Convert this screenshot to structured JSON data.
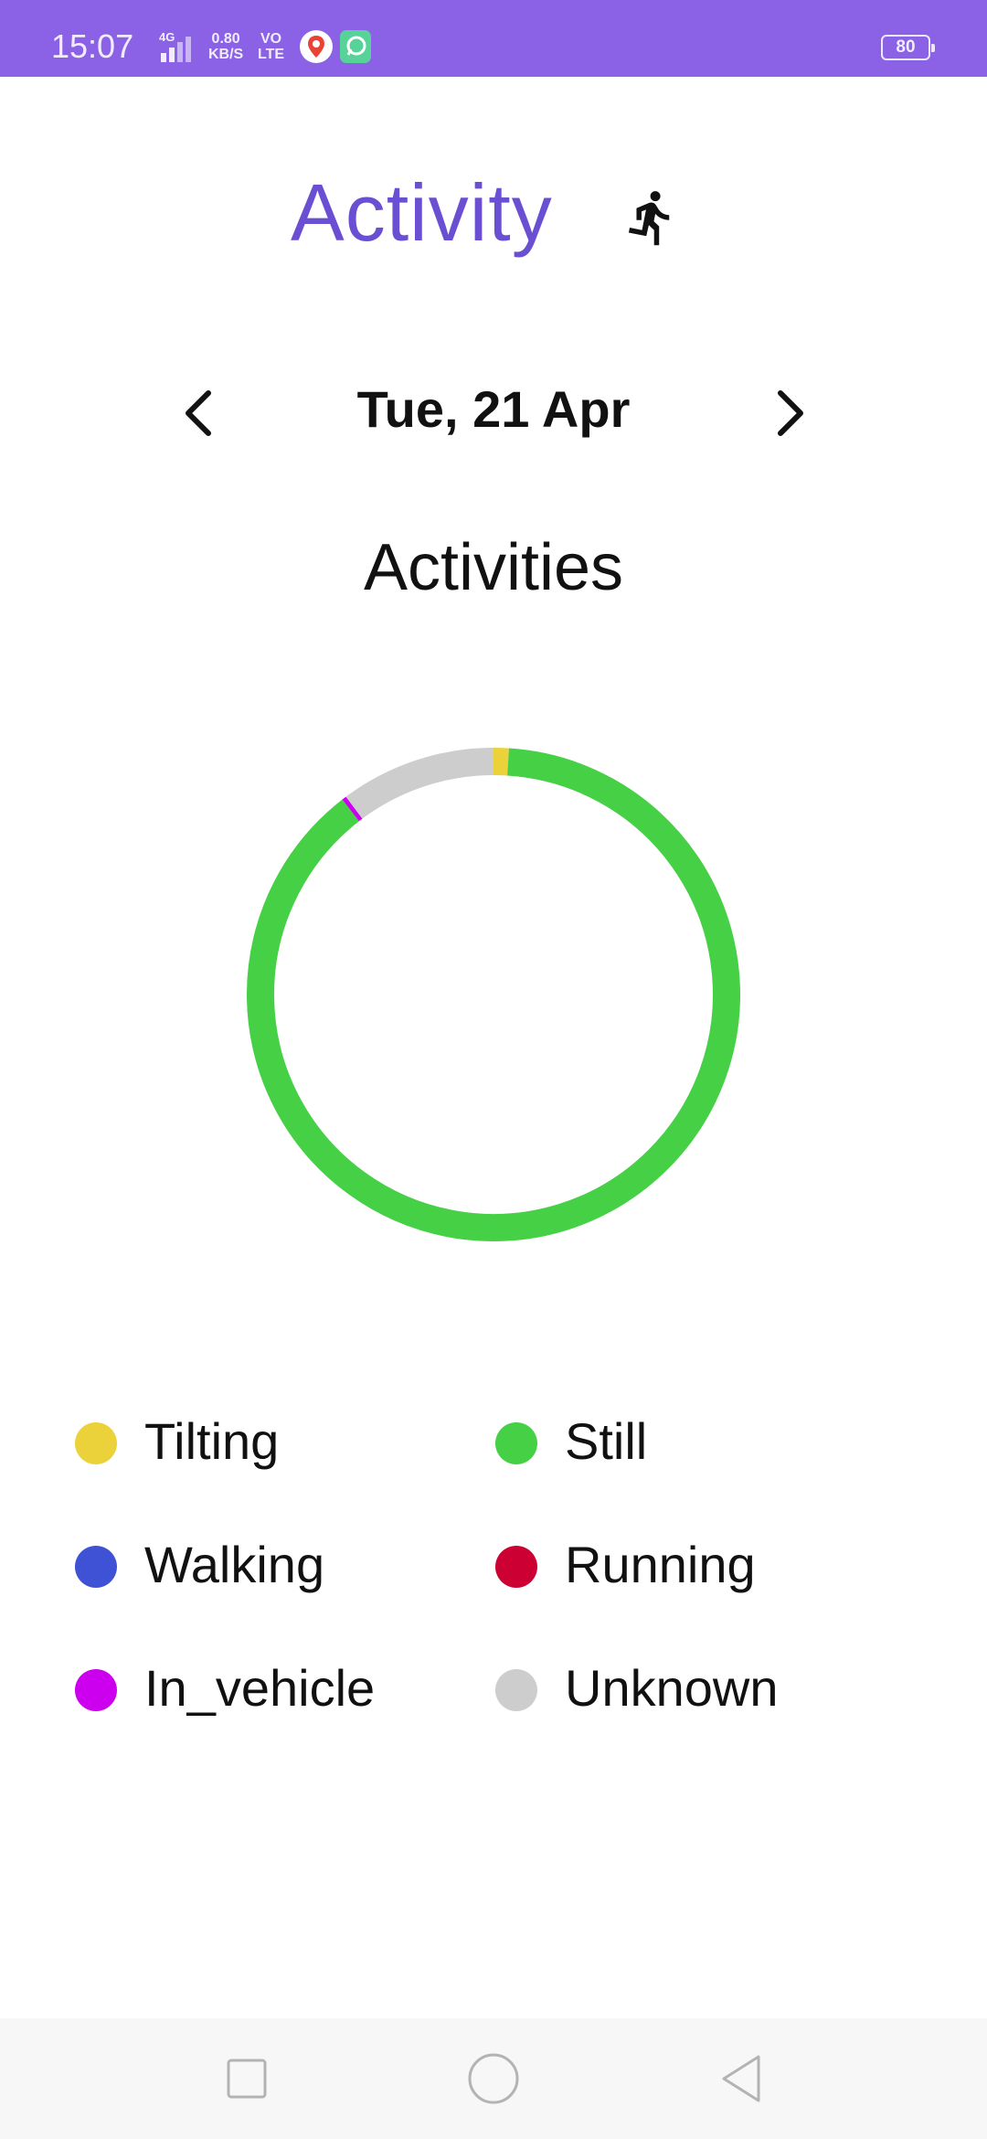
{
  "status_bar": {
    "time": "15:07",
    "network_type": "4G",
    "data_speed_value": "0.80",
    "data_speed_unit": "KB/S",
    "volte_top": "VO",
    "volte_bottom": "LTE",
    "battery": "80",
    "icons": [
      "signal-icon",
      "maps-app-icon",
      "chat-app-icon",
      "battery-icon"
    ]
  },
  "header": {
    "title": "Activity",
    "title_color": "#6a4fd3",
    "icon": "running-person-icon"
  },
  "date_nav": {
    "date": "Tue, 21 Apr",
    "prev_icon": "chevron-left-icon",
    "next_icon": "chevron-right-icon"
  },
  "section": {
    "title": "Activities"
  },
  "chart_data": {
    "type": "pie",
    "title": "Activities",
    "donut": true,
    "slices": [
      {
        "label": "Tilting",
        "value": 1.0,
        "color": "#ecd23a"
      },
      {
        "label": "Still",
        "value": 88.5,
        "color": "#46d046"
      },
      {
        "label": "Walking",
        "value": 0.0,
        "color": "#3f51d4"
      },
      {
        "label": "Running",
        "value": 0.0,
        "color": "#cc0033"
      },
      {
        "label": "In_vehicle",
        "value": 0.3,
        "color": "#cc00ee"
      },
      {
        "label": "Unknown",
        "value": 10.2,
        "color": "#cdcdcd"
      }
    ],
    "legend_position": "bottom"
  },
  "legend": [
    {
      "label": "Tilting",
      "color": "#ecd23a"
    },
    {
      "label": "Still",
      "color": "#46d046"
    },
    {
      "label": "Walking",
      "color": "#3f51d4"
    },
    {
      "label": "Running",
      "color": "#cc0033"
    },
    {
      "label": "In_vehicle",
      "color": "#cc00ee"
    },
    {
      "label": "Unknown",
      "color": "#cdcdcd"
    }
  ],
  "nav_bar": {
    "buttons": [
      "recents-square-icon",
      "home-circle-icon",
      "back-triangle-icon"
    ]
  }
}
